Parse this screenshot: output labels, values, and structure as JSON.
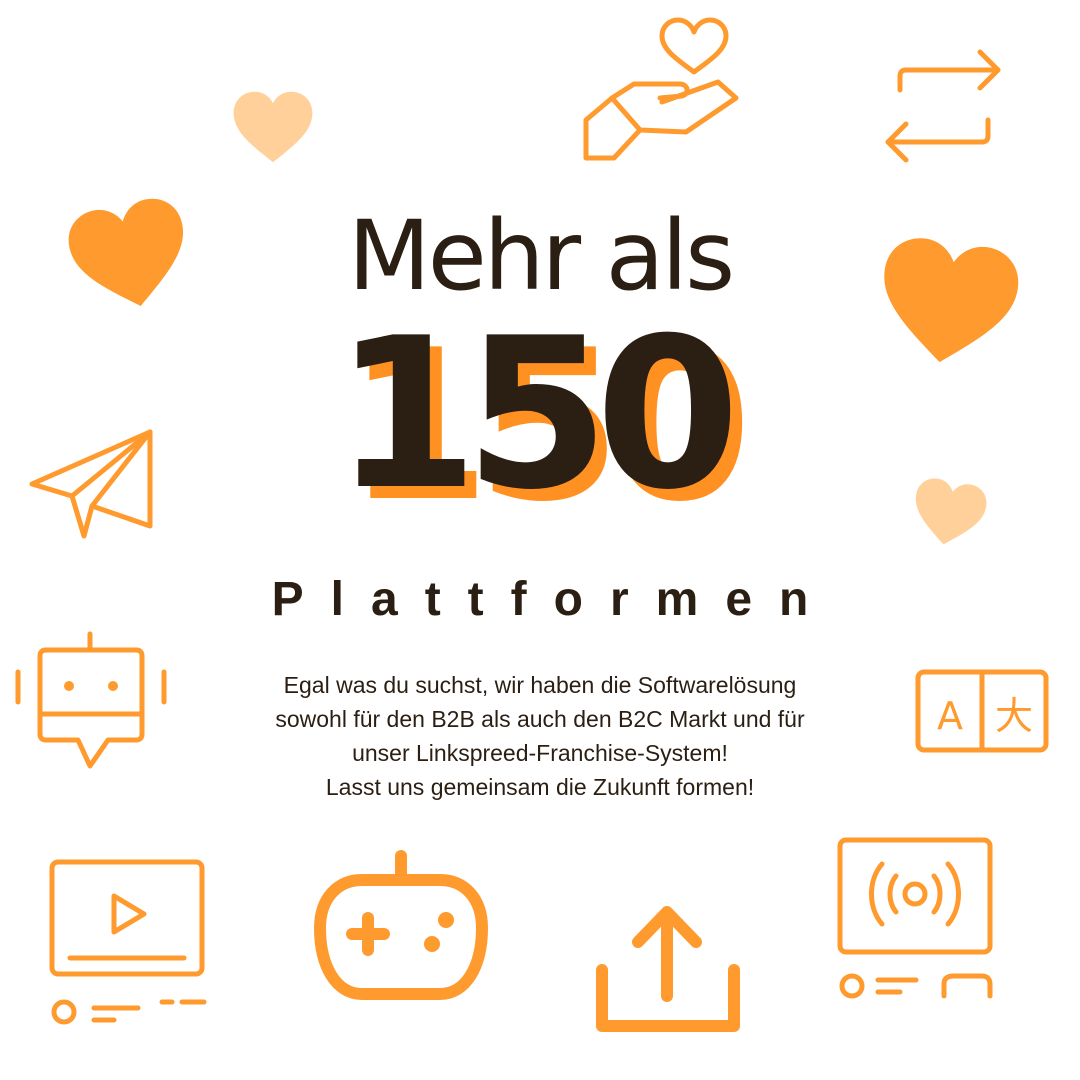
{
  "headline": "Mehr als",
  "number": "150",
  "subtitle": "Plattformen",
  "body": {
    "line1": "Egal was du suchst, wir haben die Softwarelösung",
    "line2": "sowohl für den B2B als auch den B2C Markt und für",
    "line3": "unser Linkspreed-Franchise-System!",
    "line4": "Lasst uns gemeinsam die Zukunft formen!"
  },
  "translate_icon": {
    "latin": "A",
    "cjk": "大"
  },
  "colors": {
    "accent": "#ff9a2e",
    "accent_light": "#ffd09a",
    "text": "#2b1e12",
    "background": "#ffffff"
  },
  "icons": [
    "heart-hand-icon",
    "repeat-arrows-icon",
    "heart-light-icon",
    "heart-icon",
    "paper-plane-icon",
    "robot-chat-icon",
    "translate-icon",
    "video-player-icon",
    "gamepad-icon",
    "upload-icon",
    "broadcast-icon"
  ]
}
